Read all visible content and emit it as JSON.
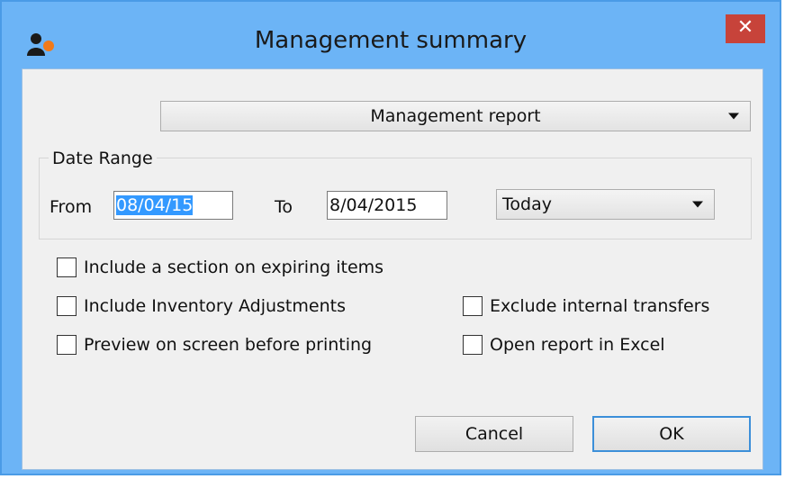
{
  "window": {
    "title": "Management summary",
    "close_label": "✕"
  },
  "report_select": {
    "value": "Management report"
  },
  "date_range": {
    "legend": "Date Range",
    "from_label": "From",
    "from_value": "08/04/15",
    "to_label": "To",
    "to_value": "8/04/2015",
    "preset_value": "Today"
  },
  "options": {
    "expiring": "Include a section on expiring items",
    "adjustments": "Include Inventory Adjustments",
    "preview": "Preview on screen before printing",
    "exclude_transfers": "Exclude internal transfers",
    "open_excel": "Open report in Excel"
  },
  "buttons": {
    "cancel": "Cancel",
    "ok": "OK"
  },
  "colors": {
    "title_bar": "#6cb4f6",
    "close_button": "#c7433a",
    "selection": "#3399ff",
    "default_button_border": "#3c8fd9"
  }
}
